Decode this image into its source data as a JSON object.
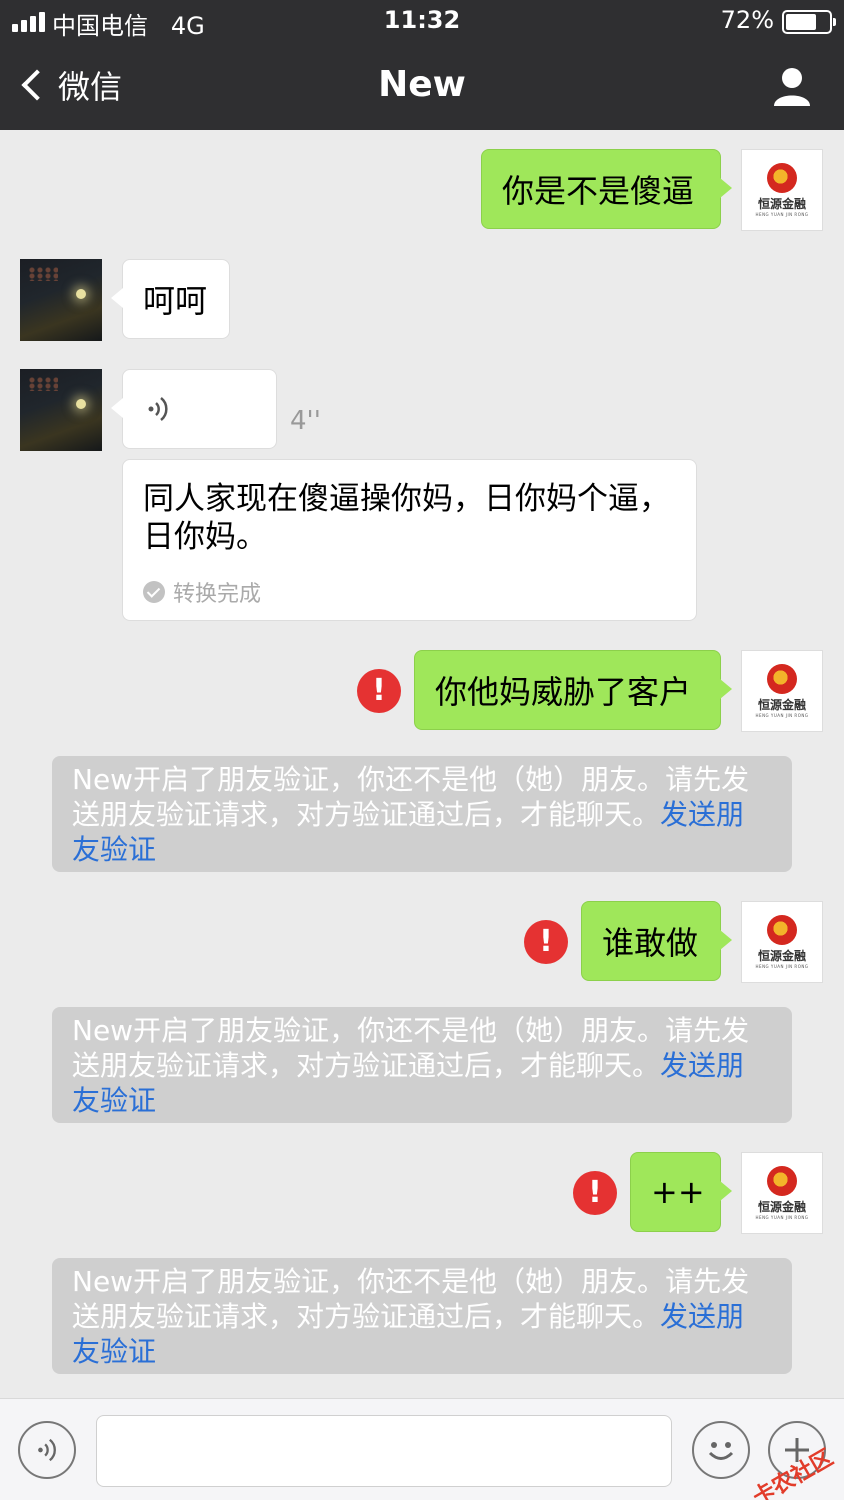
{
  "status_bar": {
    "carrier": "中国电信",
    "network": "4G",
    "time": "11:32",
    "battery_percent_text": "72%",
    "battery_level": 0.72,
    "signal_bars": 4
  },
  "nav": {
    "back_label": "微信",
    "title": "New",
    "profile_icon": "person-icon"
  },
  "messages": {
    "m1": {
      "text": "你是不是傻逼",
      "direction": "out"
    },
    "m2": {
      "text": "呵呵",
      "direction": "in"
    },
    "m3": {
      "type": "voice",
      "duration": "4''",
      "transcript": "同人家现在傻逼操你妈，日你妈个逼，日你妈。",
      "transcript_status": "转换完成"
    },
    "m4": {
      "text": "你他妈威胁了客户",
      "direction": "out",
      "failed": true
    },
    "m5": {
      "text": "谁敢做",
      "direction": "out",
      "failed": true
    },
    "m6": {
      "text": "++",
      "direction": "out",
      "failed": true
    }
  },
  "system_notice": {
    "text": "New开启了朋友验证，你还不是他（她）朋友。请先发送朋友验证请求，对方验证通过后，才能聊天。",
    "link": "发送朋友验证"
  },
  "self_avatar": {
    "logo_text": "恒源金融",
    "logo_sub": "HENG YUAN JIN RONG"
  },
  "error_mark": "!",
  "input_bar": {
    "voice_icon": "voice-icon",
    "emoji_icon": "emoji-icon",
    "more_icon": "plus-icon"
  },
  "watermark": "卡农社区",
  "colors": {
    "nav_bg": "#2f2f31",
    "chat_bg": "#ebebeb",
    "outgoing_bubble": "#9fe75a",
    "error_red": "#e53232",
    "link_blue": "#2a6fd6"
  }
}
